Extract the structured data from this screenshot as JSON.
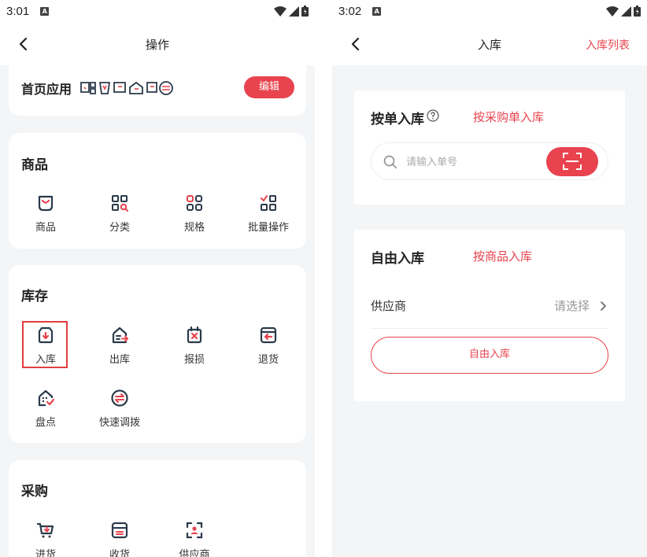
{
  "left": {
    "status": {
      "time": "3:01",
      "sim": "A"
    },
    "nav": {
      "title": "操作"
    },
    "home_apps": {
      "title": "首页应用",
      "edit_label": "编辑"
    },
    "goods": {
      "title": "商品",
      "items": [
        {
          "label": "商品",
          "icon": "bag-icon"
        },
        {
          "label": "分类",
          "icon": "category-icon"
        },
        {
          "label": "规格",
          "icon": "spec-icon"
        },
        {
          "label": "批量操作",
          "icon": "batch-icon"
        }
      ]
    },
    "stock": {
      "title": "库存",
      "items": [
        {
          "label": "入库",
          "icon": "inbound-icon"
        },
        {
          "label": "出库",
          "icon": "outbound-icon"
        },
        {
          "label": "报损",
          "icon": "damage-icon"
        },
        {
          "label": "退货",
          "icon": "return-icon"
        },
        {
          "label": "盘点",
          "icon": "inventory-check-icon"
        },
        {
          "label": "快速调拨",
          "icon": "transfer-icon"
        }
      ]
    },
    "purchase": {
      "title": "采购",
      "items": [
        {
          "label": "进货",
          "icon": "cart-icon"
        },
        {
          "label": "收货",
          "icon": "receive-icon"
        },
        {
          "label": "供应商",
          "icon": "supplier-icon"
        }
      ]
    }
  },
  "right": {
    "status": {
      "time": "3:02",
      "sim": "A"
    },
    "nav": {
      "title": "入库",
      "list_link": "入库列表"
    },
    "order_in": {
      "title": "按单入库",
      "link": "按采购单入库",
      "search_placeholder": "请输入单号"
    },
    "free_in": {
      "title": "自由入库",
      "link": "按商品入库",
      "supplier_label": "供应商",
      "supplier_value": "请选择",
      "button_label": "自由入库"
    }
  },
  "colors": {
    "accent": "#e8434e",
    "icon": "#2b3a4a",
    "background": "#f4f5f7"
  }
}
